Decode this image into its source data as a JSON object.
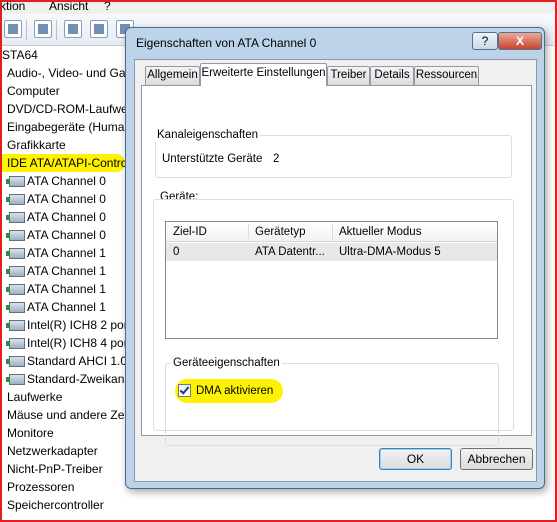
{
  "menubar": {
    "items": [
      "ktion",
      "Ansicht",
      "?"
    ]
  },
  "tree": {
    "items": [
      {
        "label": "STA64",
        "indent": 0,
        "icon": false
      },
      {
        "label": "Audio-, Video- und Ga",
        "indent": 1,
        "icon": false
      },
      {
        "label": "Computer",
        "indent": 1,
        "icon": false
      },
      {
        "label": "DVD/CD-ROM-Laufwe",
        "indent": 1,
        "icon": false
      },
      {
        "label": "Eingabegeräte (Human",
        "indent": 1,
        "icon": false
      },
      {
        "label": "Grafikkarte",
        "indent": 1,
        "icon": false
      },
      {
        "label": "IDE ATA/ATAPI-Contro",
        "indent": 1,
        "icon": false,
        "highlight": true
      },
      {
        "label": "ATA Channel 0",
        "indent": 2,
        "icon": true
      },
      {
        "label": "ATA Channel 0",
        "indent": 2,
        "icon": true
      },
      {
        "label": "ATA Channel 0",
        "indent": 2,
        "icon": true
      },
      {
        "label": "ATA Channel 0",
        "indent": 2,
        "icon": true
      },
      {
        "label": "ATA Channel 1",
        "indent": 2,
        "icon": true
      },
      {
        "label": "ATA Channel 1",
        "indent": 2,
        "icon": true
      },
      {
        "label": "ATA Channel 1",
        "indent": 2,
        "icon": true
      },
      {
        "label": "ATA Channel 1",
        "indent": 2,
        "icon": true
      },
      {
        "label": "Intel(R) ICH8 2 port",
        "indent": 2,
        "icon": true
      },
      {
        "label": "Intel(R) ICH8 4 port",
        "indent": 2,
        "icon": true
      },
      {
        "label": "Standard AHCI 1.0",
        "indent": 2,
        "icon": true
      },
      {
        "label": "Standard-Zweikana",
        "indent": 2,
        "icon": true
      },
      {
        "label": "Laufwerke",
        "indent": 1,
        "icon": false
      },
      {
        "label": "Mäuse und andere Zei",
        "indent": 1,
        "icon": false
      },
      {
        "label": "Monitore",
        "indent": 1,
        "icon": false
      },
      {
        "label": "Netzwerkadapter",
        "indent": 1,
        "icon": false
      },
      {
        "label": "Nicht-PnP-Treiber",
        "indent": 1,
        "icon": false
      },
      {
        "label": "Prozessoren",
        "indent": 1,
        "icon": false
      },
      {
        "label": "Speichercontroller",
        "indent": 1,
        "icon": false
      }
    ]
  },
  "dialog": {
    "title": "Eigenschaften von ATA Channel 0",
    "help_label": "?",
    "close_label": "X",
    "tabs": [
      {
        "label": "Allgemein"
      },
      {
        "label": "Erweiterte Einstellungen",
        "active": true
      },
      {
        "label": "Treiber"
      },
      {
        "label": "Details"
      },
      {
        "label": "Ressourcen"
      }
    ],
    "channel_group": {
      "title": "Kanaleigenschaften",
      "supported_label": "Unterstützte Geräte",
      "supported_value": "2"
    },
    "devices_group": {
      "title": "Geräte:",
      "columns": [
        "Ziel-ID",
        "Gerätetyp",
        "Aktueller Modus"
      ],
      "rows": [
        [
          "0",
          "ATA Datentr...",
          "Ultra-DMA-Modus 5"
        ]
      ]
    },
    "device_props_group": {
      "title": "Geräteeigenschaften",
      "dma_label": "DMA aktivieren",
      "dma_checked": true
    },
    "ok_label": "OK",
    "cancel_label": "Abbrechen"
  },
  "colors": {
    "highlight": "#fff200",
    "frame": "#e02020",
    "dialog_frame": "#bcd3ea"
  }
}
